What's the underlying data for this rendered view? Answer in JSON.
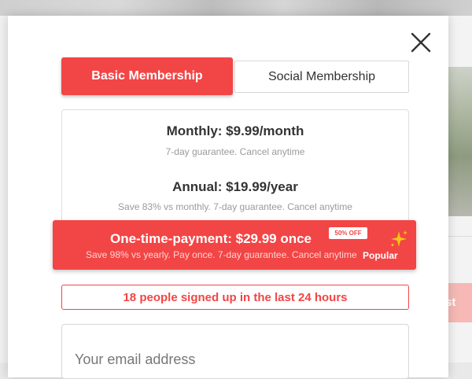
{
  "background": {
    "side_button_text": "st"
  },
  "modal": {
    "close_icon": "close-icon",
    "tabs": [
      {
        "label": "Basic Membership",
        "active": true
      },
      {
        "label": "Social Membership",
        "active": false
      }
    ],
    "plans": [
      {
        "title": "Monthly: $9.99/month",
        "subtitle": "7-day guarantee. Cancel anytime"
      },
      {
        "title": "Annual: $19.99/year",
        "subtitle": "Save 83% vs monthly. 7-day guarantee. Cancel anytime"
      }
    ],
    "popular_plan": {
      "title": "One-time-payment: $29.99 once",
      "subtitle": "Save 98% vs yearly. Pay once. 7-day guarantee. Cancel anytime",
      "badge": "50% OFF",
      "label": "Popular",
      "icon": "sparkle-icon"
    },
    "signup_notice": "18 people signed up in the last 24 hours",
    "email": {
      "value": "",
      "placeholder": "Your email address"
    }
  },
  "colors": {
    "accent": "#f24545",
    "sparkle": "#f5c518"
  }
}
